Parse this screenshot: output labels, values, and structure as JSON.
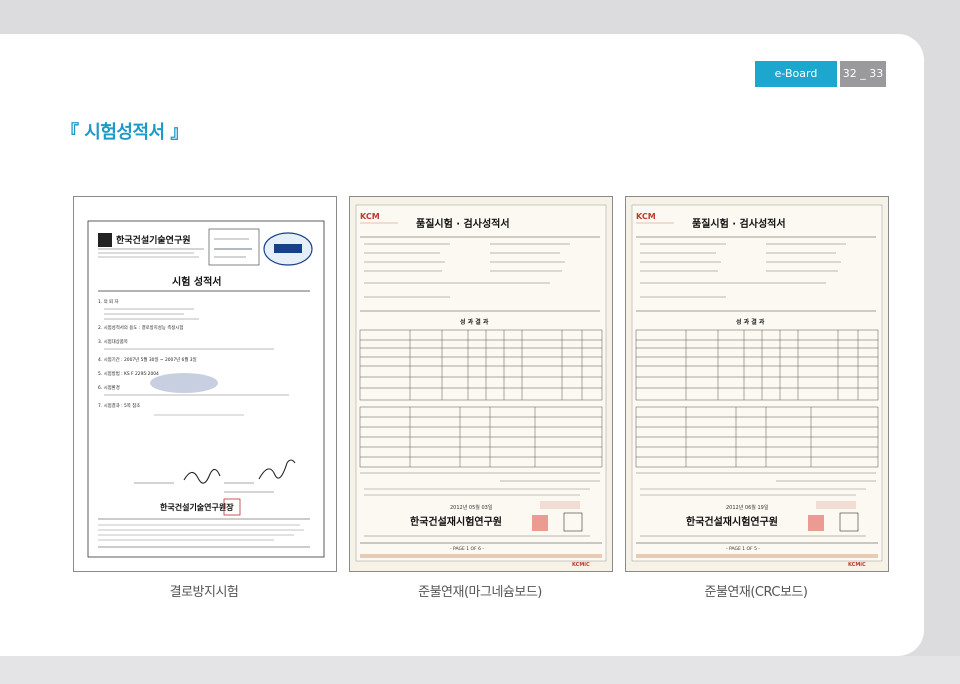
{
  "header": {
    "brand": "e-Board",
    "page_numbers": "32 _ 33"
  },
  "heading": "『 시험성적서 』",
  "documents": [
    {
      "caption": "결로방지시험",
      "org": "한국건설기술연구원",
      "title": "시험 성적서",
      "items": [
        "1. 의 뢰 자",
        "2. 시험성적서의 용도 : 결로방지성능 측정시험",
        "3. 시험대상품목",
        "4. 시험기간 : 2007년 5월 30일 ~ 2007년 6월 3일",
        "5. 시험방법 : KS F 2295:2004",
        "6. 시험환경",
        "7. 시험결과 : 5쪽 참조"
      ],
      "footer_org": "한국건설기술연구원장"
    },
    {
      "caption": "준불연재(마그네슘보드)",
      "logo": "KCM",
      "title": "품질시험 · 검사성적서",
      "results_title": "성 과 결 과",
      "date": "2012년 05월 03일",
      "footer_org": "한국건설재시험연구원",
      "page": "- PAGE 1 OF 6 -"
    },
    {
      "caption": "준불연재(CRC보드)",
      "logo": "KCM",
      "title": "품질시험 · 검사성적서",
      "results_title": "성 과 결 과",
      "date": "2012년 06월 19일",
      "footer_org": "한국건설재시험연구원",
      "page": "- PAGE 1 OF 5 -"
    }
  ],
  "colors": {
    "accent": "#1e9ac9",
    "brand_box": "#1da7ce",
    "page_box": "#9a9a9c"
  }
}
